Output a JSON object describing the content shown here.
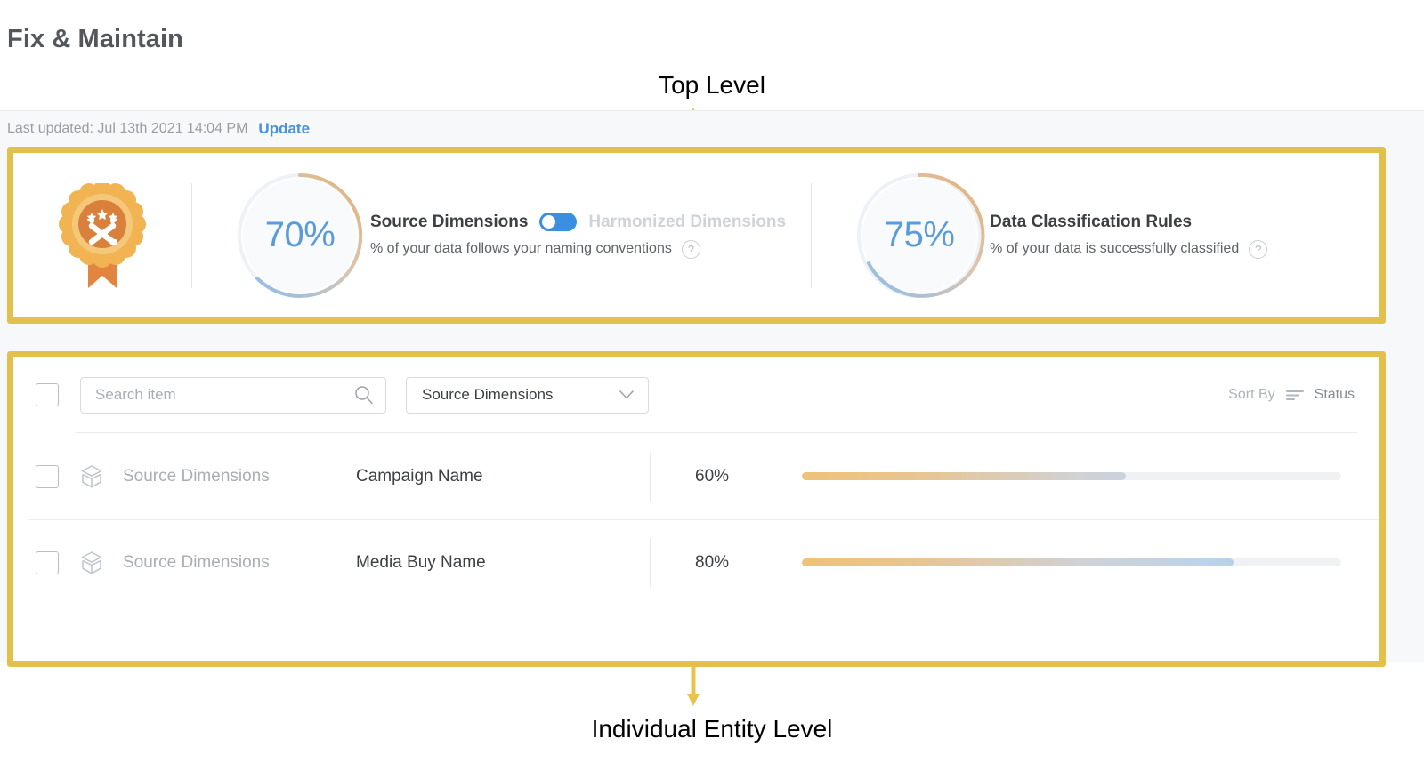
{
  "page": {
    "title": "Fix & Maintain"
  },
  "annotations": {
    "top": "Top Level",
    "bottom": "Individual Entity Level",
    "highlight_color": "#e3c04b"
  },
  "status_bar": {
    "last_updated": "Last updated: Jul 13th 2021 14:04 PM",
    "update_label": "Update",
    "update_link_color": "#4a90d9"
  },
  "summary": {
    "badge_icon": "award-medal-tools-icon",
    "metrics": [
      {
        "value": "70%",
        "percent": 70,
        "title": "Source Dimensions",
        "toggle_alt_title": "Harmonized Dimensions",
        "toggle_on": true,
        "subtitle": "% of your data follows your naming conventions",
        "help_icon": "help-circle-icon"
      },
      {
        "value": "75%",
        "percent": 75,
        "title": "Data Classification Rules",
        "subtitle": "% of your data is successfully classified",
        "help_icon": "help-circle-icon"
      }
    ]
  },
  "list": {
    "toolbar": {
      "select_all_checkbox": false,
      "search_placeholder": "Search item",
      "search_value": "",
      "search_icon": "search-icon",
      "filter_selected": "Source Dimensions",
      "filter_chevron_icon": "chevron-down-icon",
      "sort_by_label": "Sort By",
      "sort_icon": "sort-lines-icon",
      "sort_value": "Status"
    },
    "rows": [
      {
        "checked": false,
        "icon": "cube-box-icon",
        "type": "Source Dimensions",
        "name": "Campaign Name",
        "percent_label": "60%",
        "percent": 60
      },
      {
        "checked": false,
        "icon": "cube-box-icon",
        "type": "Source Dimensions",
        "name": "Media Buy Name",
        "percent_label": "80%",
        "percent": 80
      }
    ]
  }
}
